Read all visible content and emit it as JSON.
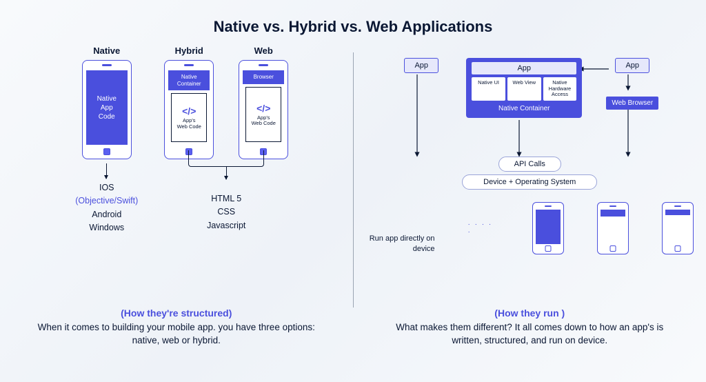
{
  "title": "Native vs. Hybrid vs. Web Applications",
  "left": {
    "phones": {
      "native": {
        "label": "Native",
        "screen_text": "Native\nApp\nCode"
      },
      "hybrid": {
        "label": "Hybrid",
        "header": "Native\nContainer",
        "body_label": "App's\nWeb Code"
      },
      "web": {
        "label": "Web",
        "header": "Browser",
        "body_label": "App's\nWeb Code"
      }
    },
    "native_tech": {
      "line1": "IOS",
      "line2": "(Objective/Swift)",
      "line3": "Android",
      "line4": "Windows"
    },
    "web_tech": {
      "line1": "HTML 5",
      "line2": "CSS",
      "line3": "Javascript"
    },
    "footer": {
      "subhead": "(How they're structured)",
      "body": "When it comes to building your mobile app. you have three options: native, web or hybrid."
    }
  },
  "right": {
    "app_label": "App",
    "container": {
      "app_label": "App",
      "cells": {
        "native_ui": "Native UI",
        "web_view": "Web View",
        "hardware": "Native\nHardware\nAccess"
      },
      "label": "Native Container"
    },
    "web_browser": "Web Browser",
    "api_calls": "API Calls",
    "device_os": "Device + Operating System",
    "run_label": "Run app directly on device",
    "footer": {
      "subhead": "(How they run )",
      "body": "What makes them different? It all comes down to how an app's is written, structured, and run on device."
    }
  }
}
